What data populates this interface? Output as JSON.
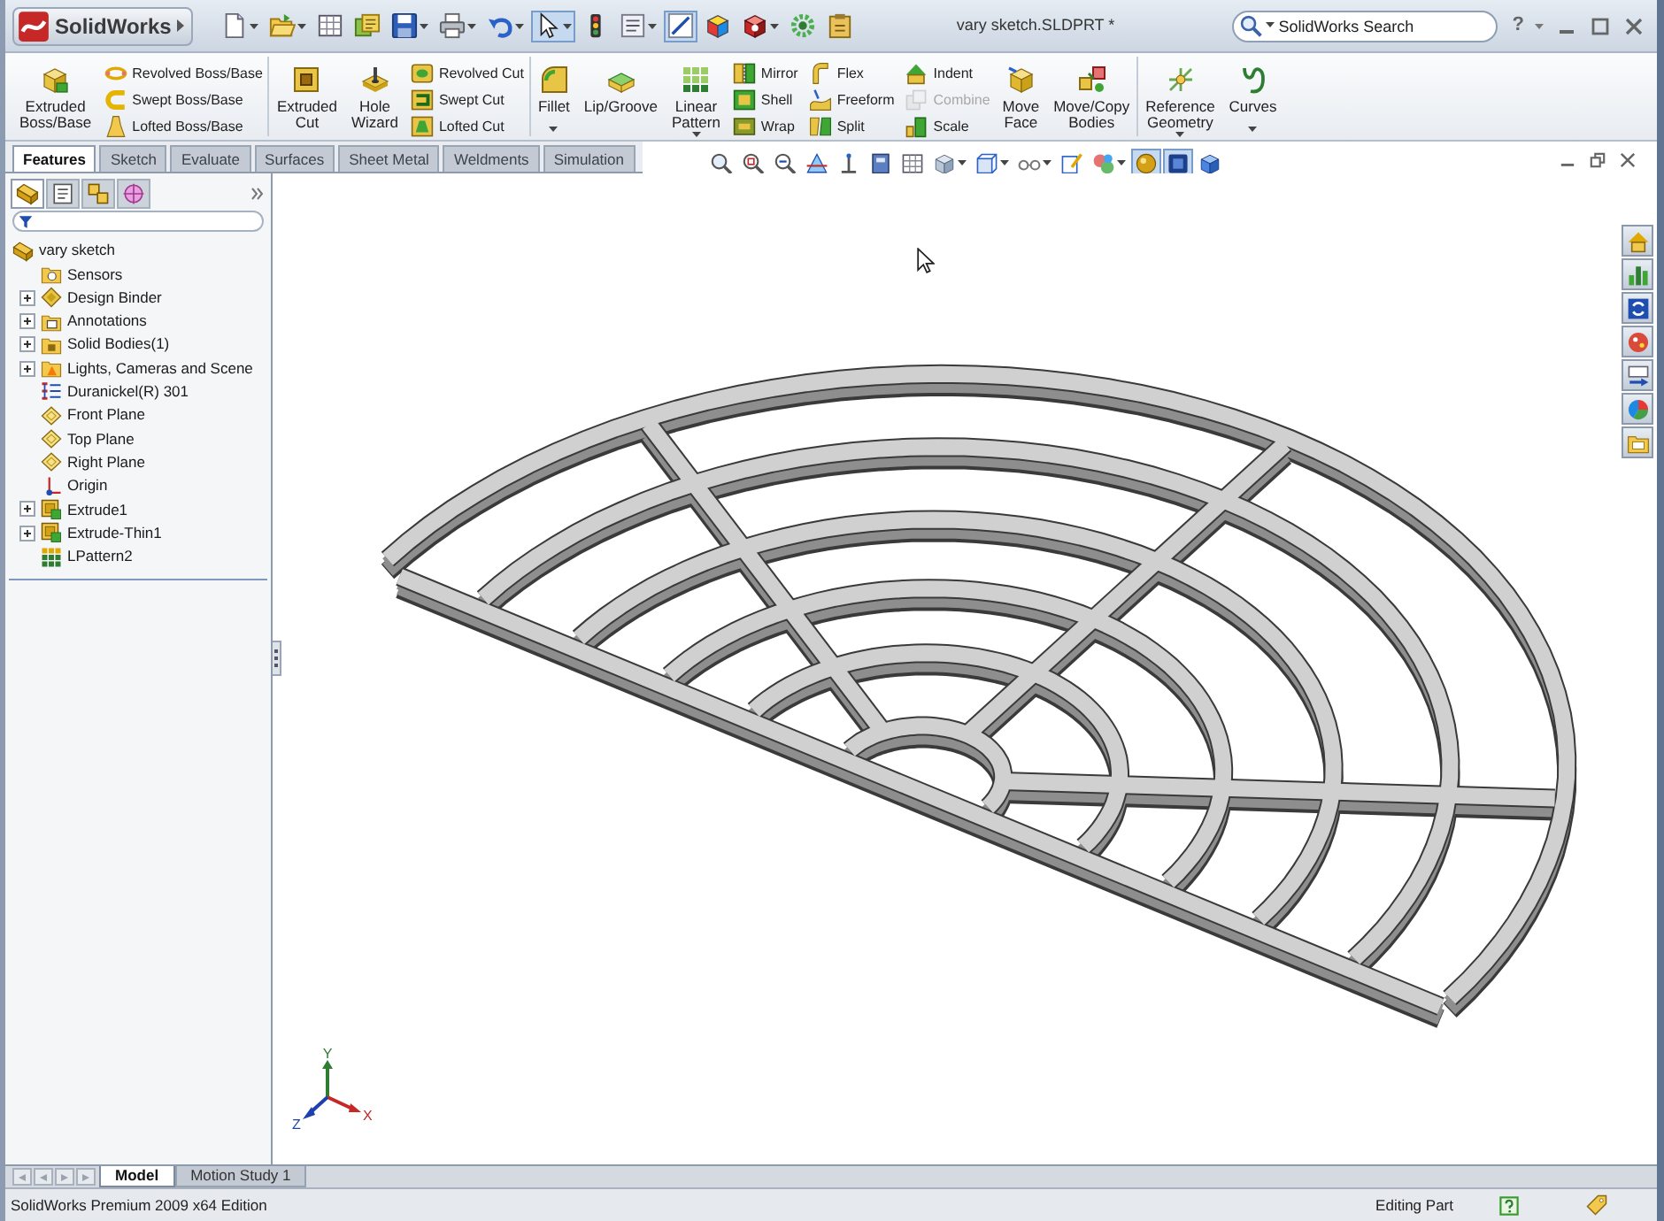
{
  "title_bar": {
    "logo": "SolidWorks",
    "document_title": "vary sketch.SLDPRT *",
    "search": {
      "placeholder": "SolidWorks Search"
    },
    "help": "?"
  },
  "quick_access_toolbar": [
    {
      "pressed": false,
      "dropdown": true
    },
    {
      "pressed": false,
      "dropdown": true
    },
    {
      "pressed": false,
      "dropdown": false
    },
    {
      "pressed": false,
      "dropdown": false
    },
    {
      "pressed": false,
      "dropdown": true
    },
    {
      "pressed": false,
      "dropdown": true
    },
    {
      "pressed": false,
      "dropdown": true
    },
    {
      "pressed": true,
      "dropdown": true
    },
    {
      "pressed": false,
      "dropdown": false
    },
    {
      "pressed": false,
      "dropdown": true
    },
    {
      "pressed": true,
      "dropdown": false
    },
    {
      "pressed": false,
      "dropdown": false
    },
    {
      "pressed": false,
      "dropdown": true
    },
    {
      "pressed": false,
      "dropdown": false
    },
    {
      "pressed": false,
      "dropdown": false
    }
  ],
  "ribbon": {
    "groups": [
      {
        "items": [
          {
            "kind": "large",
            "label": "Extruded Boss/Base",
            "dropdown": false,
            "disabled": false
          },
          {
            "kind": "stack",
            "items": [
              {
                "label": "Revolved Boss/Base",
                "disabled": false
              },
              {
                "label": "Swept Boss/Base",
                "disabled": false
              },
              {
                "label": "Lofted Boss/Base",
                "disabled": false
              }
            ]
          }
        ]
      },
      {
        "items": [
          {
            "kind": "large",
            "label": "Extruded Cut",
            "dropdown": false,
            "disabled": false
          },
          {
            "kind": "large",
            "label": "Hole Wizard",
            "dropdown": false,
            "disabled": false
          },
          {
            "kind": "stack",
            "items": [
              {
                "label": "Revolved Cut",
                "disabled": false
              },
              {
                "label": "Swept Cut",
                "disabled": false
              },
              {
                "label": "Lofted Cut",
                "disabled": false
              }
            ]
          }
        ]
      },
      {
        "items": [
          {
            "kind": "large",
            "label": "Fillet",
            "dropdown": true,
            "disabled": false
          },
          {
            "kind": "large",
            "label": "Lip/Groove",
            "dropdown": false,
            "disabled": false
          },
          {
            "kind": "large",
            "label": "Linear Pattern",
            "dropdown": true,
            "disabled": false
          },
          {
            "kind": "stack",
            "items": [
              {
                "label": "Mirror",
                "disabled": false
              },
              {
                "label": "Shell",
                "disabled": false
              },
              {
                "label": "Wrap",
                "disabled": false
              }
            ]
          },
          {
            "kind": "stack",
            "items": [
              {
                "label": "Flex",
                "disabled": false
              },
              {
                "label": "Freeform",
                "disabled": false
              },
              {
                "label": "Split",
                "disabled": false
              }
            ]
          },
          {
            "kind": "stack",
            "items": [
              {
                "label": "Indent",
                "disabled": false
              },
              {
                "label": "Combine",
                "disabled": true
              },
              {
                "label": "Scale",
                "disabled": false
              }
            ]
          },
          {
            "kind": "large",
            "label": "Move Face",
            "dropdown": false,
            "disabled": false
          },
          {
            "kind": "large",
            "label": "Move/Copy Bodies",
            "dropdown": false,
            "disabled": false
          }
        ]
      },
      {
        "items": [
          {
            "kind": "large",
            "label": "Reference Geometry",
            "dropdown": true,
            "disabled": false
          },
          {
            "kind": "large",
            "label": "Curves",
            "dropdown": true,
            "disabled": false
          }
        ]
      }
    ]
  },
  "command_tabs": [
    {
      "label": "Features",
      "selected": true
    },
    {
      "label": "Sketch",
      "selected": false
    },
    {
      "label": "Evaluate",
      "selected": false
    },
    {
      "label": "Surfaces",
      "selected": false
    },
    {
      "label": "Sheet Metal",
      "selected": false
    },
    {
      "label": "Weldments",
      "selected": false
    },
    {
      "label": "Simulation",
      "selected": false
    }
  ],
  "view_toolbar": [
    {
      "pressed": false,
      "dropdown": false
    },
    {
      "pressed": false,
      "dropdown": false
    },
    {
      "pressed": false,
      "dropdown": false
    },
    {
      "pressed": false,
      "dropdown": false
    },
    {
      "pressed": false,
      "dropdown": false
    },
    {
      "pressed": false,
      "dropdown": false
    },
    {
      "pressed": false,
      "dropdown": false
    },
    {
      "pressed": false,
      "dropdown": true
    },
    {
      "pressed": false,
      "dropdown": true
    },
    {
      "pressed": false,
      "dropdown": true
    },
    {
      "pressed": false,
      "dropdown": false
    },
    {
      "pressed": false,
      "dropdown": true
    },
    {
      "pressed": true,
      "dropdown": false
    },
    {
      "pressed": true,
      "dropdown": false
    },
    {
      "pressed": false,
      "dropdown": false
    }
  ],
  "feature_manager": {
    "tabs": [
      {
        "selected": true
      },
      {
        "selected": false
      },
      {
        "selected": false
      },
      {
        "selected": false
      }
    ],
    "tree": {
      "label": "vary sketch",
      "kind": "part",
      "children": [
        {
          "label": "Sensors",
          "kind": "sensors",
          "expandable": false
        },
        {
          "label": "Design Binder",
          "kind": "binder",
          "expandable": true
        },
        {
          "label": "Annotations",
          "kind": "annotations",
          "expandable": true
        },
        {
          "label": "Solid Bodies(1)",
          "kind": "bodies",
          "expandable": true
        },
        {
          "label": "Lights, Cameras and Scene",
          "kind": "lights",
          "expandable": true
        },
        {
          "label": "Duranickel(R) 301",
          "kind": "material",
          "expandable": false
        },
        {
          "label": "Front Plane",
          "kind": "plane",
          "expandable": false
        },
        {
          "label": "Top Plane",
          "kind": "plane",
          "expandable": false
        },
        {
          "label": "Right Plane",
          "kind": "plane",
          "expandable": false
        },
        {
          "label": "Origin",
          "kind": "origin",
          "expandable": false
        },
        {
          "label": "Extrude1",
          "kind": "extrude",
          "expandable": true
        },
        {
          "label": "Extrude-Thin1",
          "kind": "extrude",
          "expandable": true
        },
        {
          "label": "LPattern2",
          "kind": "pattern",
          "expandable": false
        }
      ]
    }
  },
  "graphics_area": {
    "triad": {
      "x_label": "X",
      "y_label": "Y",
      "z_label": "Z"
    }
  },
  "bottom_tabs": [
    {
      "label": "Model",
      "selected": true
    },
    {
      "label": "Motion Study 1",
      "selected": false
    }
  ],
  "status_bar": {
    "edition": "SolidWorks Premium 2009 x64 Edition",
    "mode": "Editing Part"
  }
}
